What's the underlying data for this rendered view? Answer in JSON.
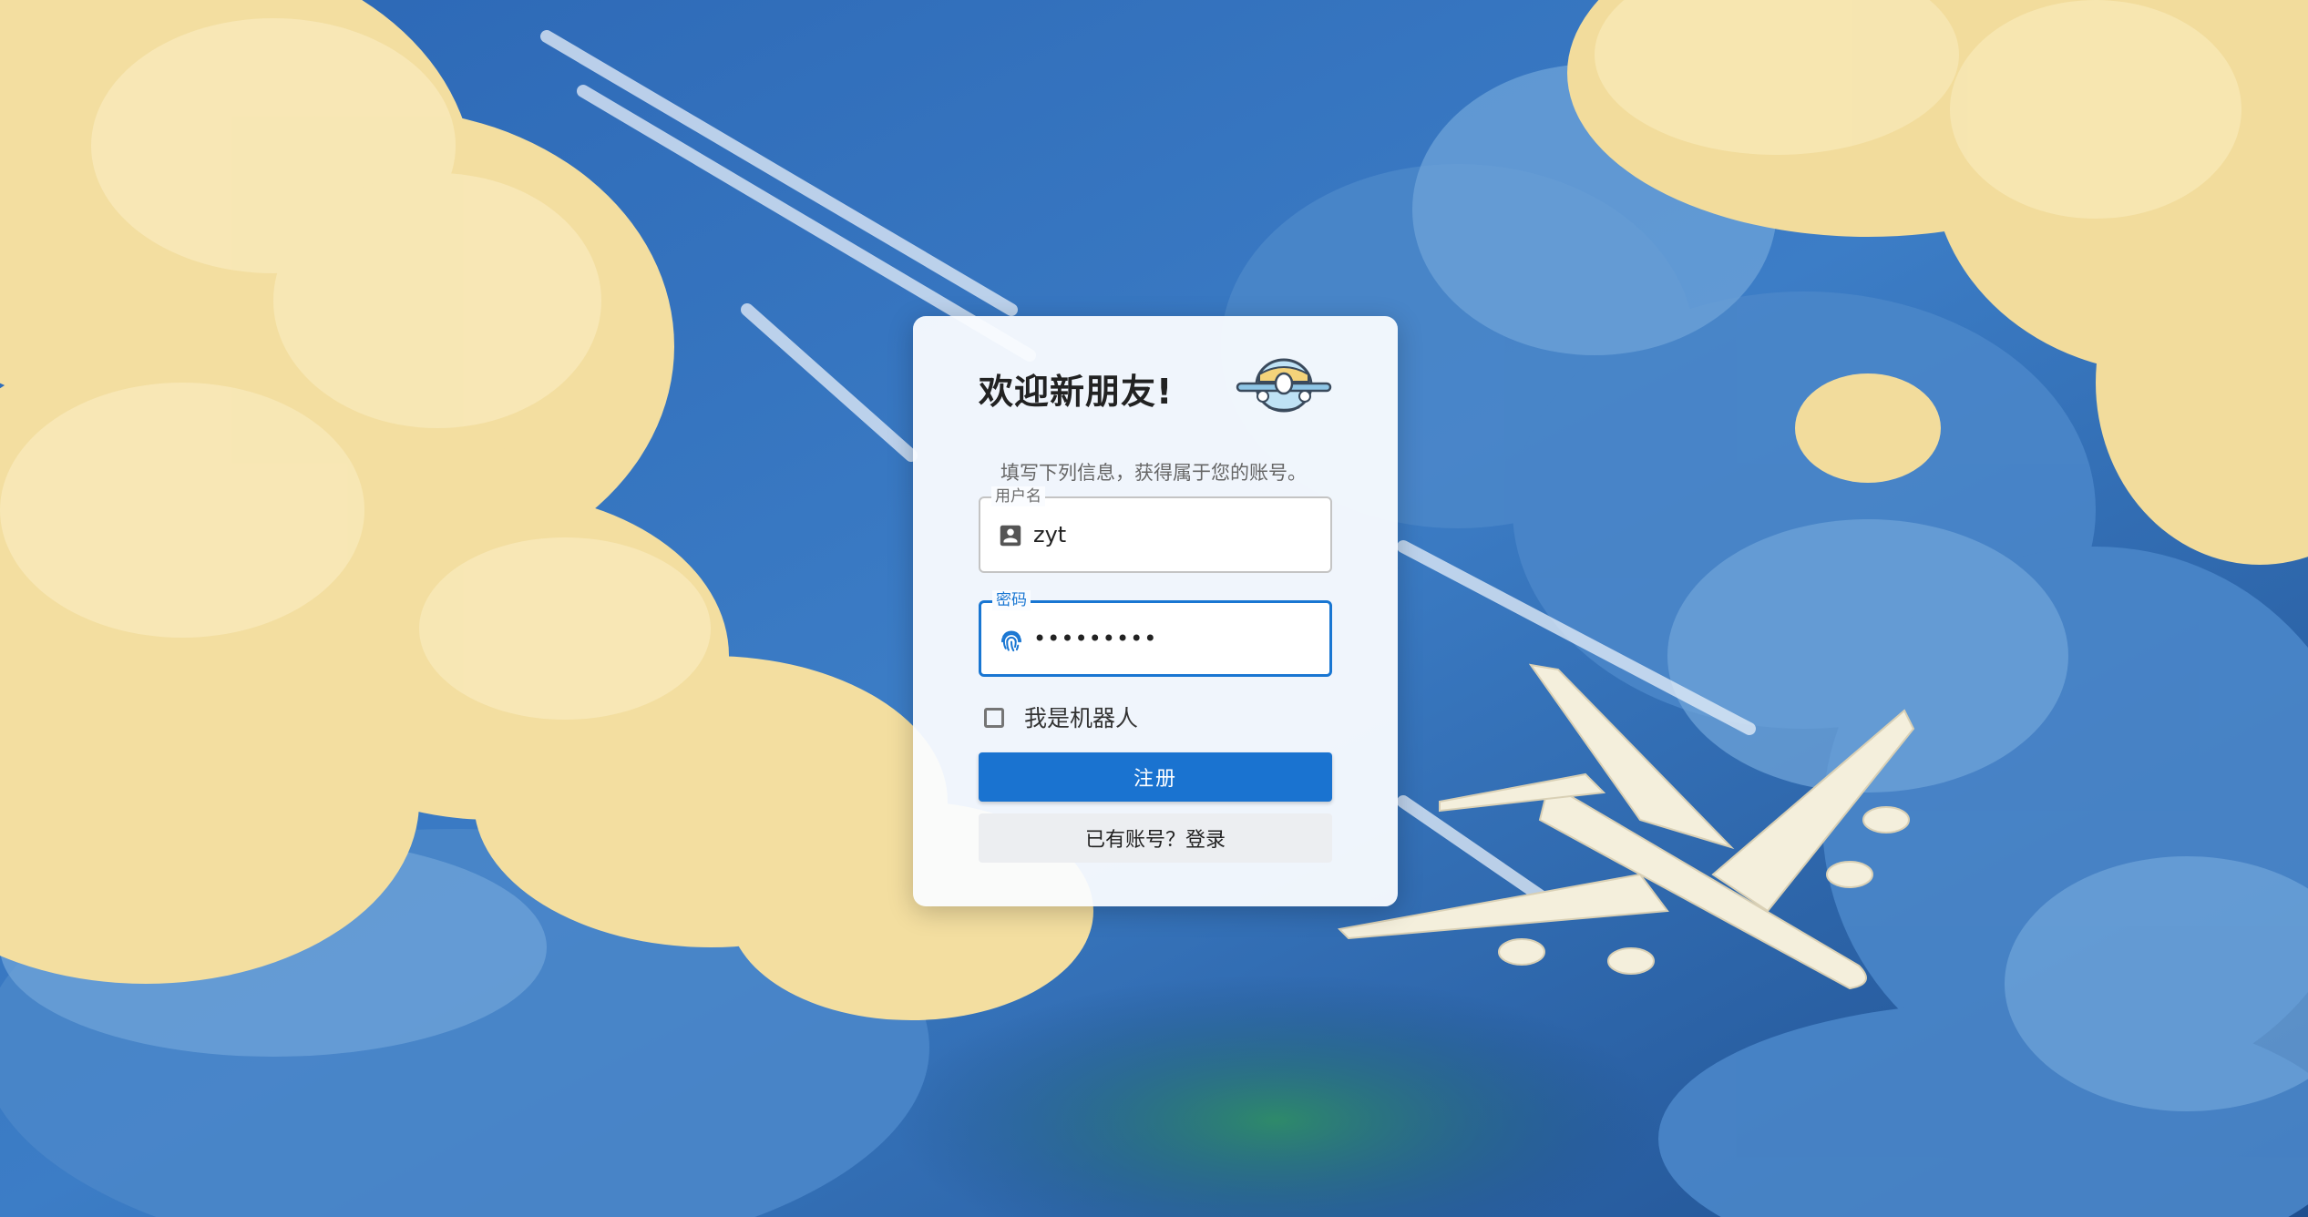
{
  "form": {
    "title": "欢迎新朋友!",
    "subtitle": "填写下列信息，获得属于您的账号。",
    "logo_icon": "airplane-mascot-icon",
    "username": {
      "label": "用户名",
      "value": "zyt",
      "icon": "account-box-icon"
    },
    "password": {
      "label": "密码",
      "value": "•••••••••",
      "icon": "fingerprint-icon"
    },
    "robot_checkbox": {
      "label": "我是机器人",
      "checked": false
    },
    "register_label": "注册",
    "login_label": "已有账号？登录"
  },
  "colors": {
    "accent": "#1a73d0",
    "secondary_button": "#eceef1",
    "card": "#fafcff"
  }
}
